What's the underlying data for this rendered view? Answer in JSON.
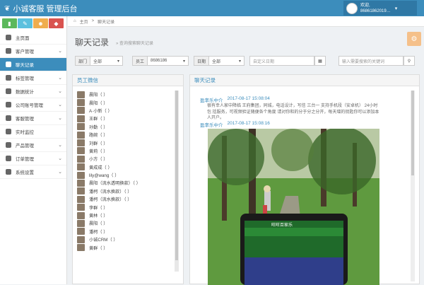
{
  "app": {
    "logo_text": "小诚客服 管理后台"
  },
  "user": {
    "line1": "欢迎,",
    "line2": "86861862019…"
  },
  "colors": {
    "primary": "#3c8dbc",
    "btn1": "#5cb85c",
    "btn2": "#5bc0de",
    "btn3": "#f0ad4e",
    "btn4": "#d9534f"
  },
  "sidebar": {
    "buttons": [
      {
        "icon": "chart-icon",
        "glyph": "▮"
      },
      {
        "icon": "pencil-icon",
        "glyph": "✎"
      },
      {
        "icon": "users-icon",
        "glyph": "☻"
      },
      {
        "icon": "share-icon",
        "glyph": "◆"
      }
    ],
    "items": [
      {
        "label": "主页面",
        "icon": "dashboard-icon",
        "chev": ""
      },
      {
        "label": "客户管理",
        "icon": "customer-icon",
        "chev": "⌄"
      },
      {
        "label": "聊天记录",
        "icon": "chat-icon",
        "chev": "",
        "active": true
      },
      {
        "label": "标签管理",
        "icon": "tag-icon",
        "chev": "⌄"
      },
      {
        "label": "数据统计",
        "icon": "stats-icon",
        "chev": "⌄"
      },
      {
        "label": "公司账号管理",
        "icon": "account-icon",
        "chev": "⌄"
      },
      {
        "label": "客服管理",
        "icon": "service-icon",
        "chev": "⌄"
      },
      {
        "label": "实时监控",
        "icon": "monitor-icon",
        "chev": ""
      },
      {
        "label": "产品管理",
        "icon": "product-icon",
        "chev": "⌄"
      },
      {
        "label": "订单管理",
        "icon": "order-icon",
        "chev": "⌄"
      },
      {
        "label": "系统设置",
        "icon": "settings-icon",
        "chev": "⌄"
      }
    ]
  },
  "breadcrumb": {
    "home": "主页",
    "sep": ">",
    "current": "聊天记录"
  },
  "page": {
    "title": "聊天记录",
    "subtitle": "» 查询搜索聊天记录"
  },
  "filters": {
    "dept_label": "部门",
    "dept_value": "全部",
    "staff_label": "员工",
    "staff_value": "8686186",
    "date_label": "日期",
    "date_value": "全部",
    "custom_date": "自定义日期",
    "search_placeholder": "输入需要搜索的关键词"
  },
  "left_panel": {
    "title": "员工微信",
    "contacts": [
      "晨阳（ ）",
      "晨阳（ ）",
      "A·小新（ ）",
      "王群（ ）",
      "孙勤（ ）",
      "路婉（ ）",
      "刘群（ ）",
      "黄莉（ ）",
      "小方（ ）",
      "黄成成（ ）",
      "lily@wang（ ）",
      "晨阳（流水透明换款）（ ）",
      "潘柯（流水换款）（ ）",
      "潘柯（流水换款）（ ）",
      "李群（ ）",
      "黄林（ ）",
      "晨阳（ ）",
      "潘柯（ ）",
      "小诚CRM（ ）",
      "黄群（ ）"
    ]
  },
  "right_panel": {
    "title": "聊天记录",
    "msg1": {
      "name": "盈率乐中介",
      "time": "2017-08-17 15:08:04",
      "text": "很有幸人家中降临 王府集团，同城，电话设计，写信 三台一 支持手机段（安卓机） 24小时包 括服务，可视频验证随便各个角度 请对你和的分于分之分开，每天增的钥匙你可以添加本人开户。"
    },
    "msg2": {
      "name": "盈率乐中介",
      "time": "2017-08-17 15:08:16"
    },
    "phone_banner": "旺旺百家乐"
  }
}
